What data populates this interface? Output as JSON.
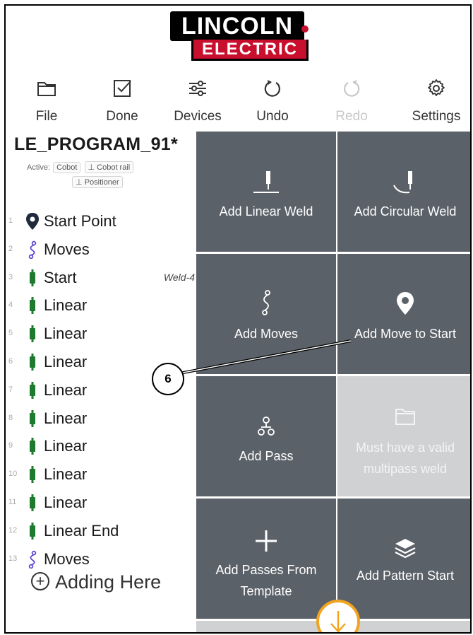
{
  "logo": {
    "top": "LINCOLN",
    "bottom": "ELECTRIC"
  },
  "toolbar": {
    "file": "File",
    "done": "Done",
    "devices": "Devices",
    "undo": "Undo",
    "redo": "Redo",
    "settings": "Settings"
  },
  "program": {
    "title": "LE_PROGRAM_91*",
    "active_label": "Active:",
    "chips": [
      "Cobot",
      "Cobot rail",
      "Positioner"
    ]
  },
  "steps": [
    {
      "num": "1",
      "label": "Start Point",
      "icon": "location-pin-icon"
    },
    {
      "num": "2",
      "label": "Moves",
      "icon": "moves-path-icon"
    },
    {
      "num": "3",
      "label": "Start",
      "icon": "weld-torch-icon",
      "tag": "Weld-4"
    },
    {
      "num": "4",
      "label": "Linear",
      "icon": "weld-torch-icon"
    },
    {
      "num": "5",
      "label": "Linear",
      "icon": "weld-torch-icon"
    },
    {
      "num": "6",
      "label": "Linear",
      "icon": "weld-torch-icon"
    },
    {
      "num": "7",
      "label": "Linear",
      "icon": "weld-torch-icon"
    },
    {
      "num": "8",
      "label": "Linear",
      "icon": "weld-torch-icon"
    },
    {
      "num": "9",
      "label": "Linear",
      "icon": "weld-torch-icon"
    },
    {
      "num": "10",
      "label": "Linear",
      "icon": "weld-torch-icon"
    },
    {
      "num": "11",
      "label": "Linear",
      "icon": "weld-torch-icon"
    },
    {
      "num": "12",
      "label": "Linear End",
      "icon": "weld-torch-icon"
    },
    {
      "num": "13",
      "label": "Moves",
      "icon": "moves-path-icon"
    }
  ],
  "adding_here": "Adding Here",
  "tiles": {
    "linear_weld": "Add Linear Weld",
    "circular_weld": "Add Circular Weld",
    "moves": "Add Moves",
    "move_to_start": "Add Move to Start",
    "pass": "Add Pass",
    "disabled_line1": "Must have a valid",
    "disabled_line2": "multipass weld",
    "template_line1": "Add Passes From",
    "template_line2": "Template",
    "pattern_start": "Add Pattern Start"
  },
  "callout": "6",
  "colors": {
    "tile": "#5b6168",
    "tile_disabled": "#cfd1d3",
    "torch_green": "#1e7a2e",
    "moves_purple": "#5b3fd0",
    "logo_red": "#c8102e",
    "fab_orange": "#f2a420"
  }
}
